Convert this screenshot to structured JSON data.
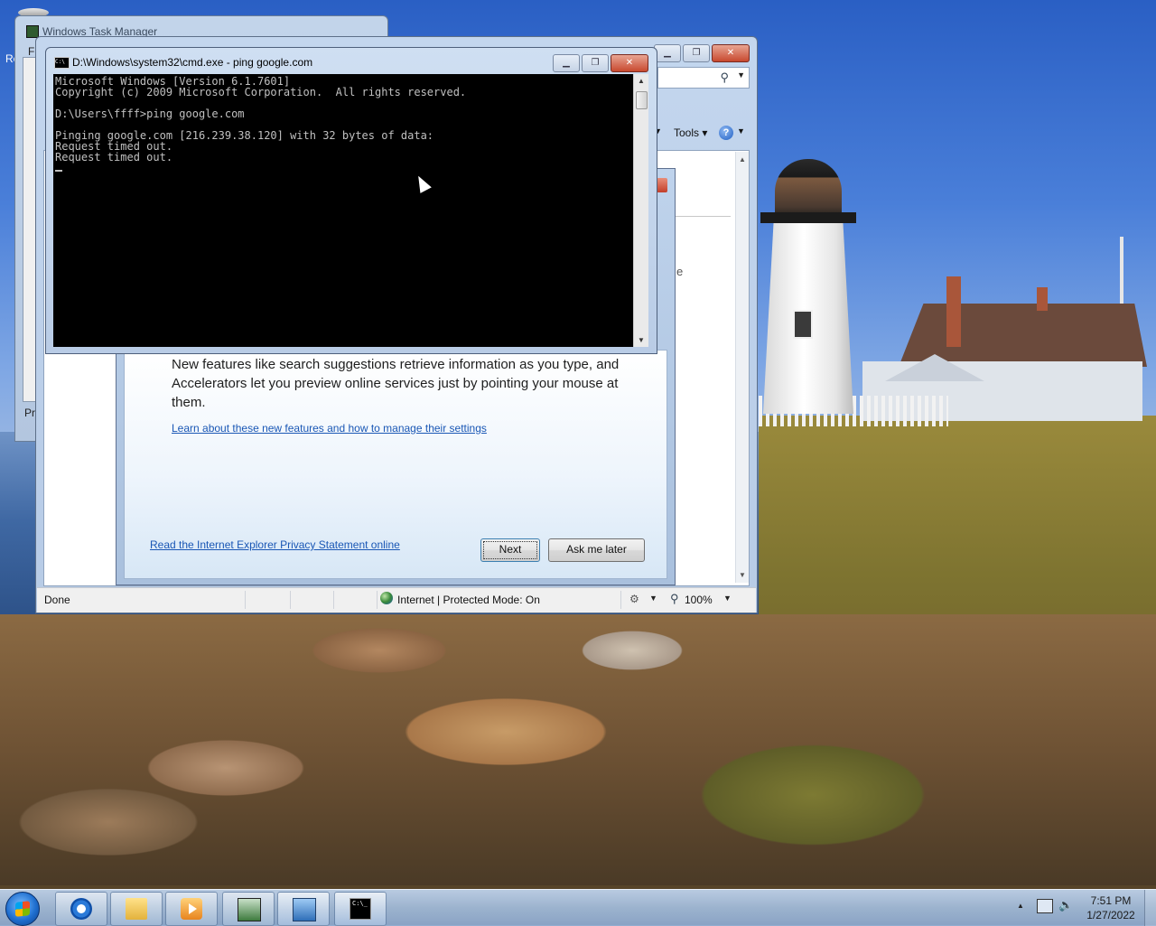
{
  "desktop": {
    "left_edge_label": "Re"
  },
  "task_manager": {
    "title": "Windows Task Manager",
    "menu_first": "Fi",
    "footer_partial": "Pr"
  },
  "ie_window": {
    "search_icon": "search-icon",
    "command_bar": {
      "tools_label": "Tools",
      "help_label": "?"
    },
    "content_partial_text": "e",
    "status_bar": {
      "status_text": "Done",
      "zone_text": "Internet | Protected Mode: On",
      "zoom_text": "100%"
    }
  },
  "welcome_dialog": {
    "description": "New features like search suggestions retrieve information as you type, and Accelerators let you preview online services just by pointing your mouse at them.",
    "features_link": "Learn about these new features and how to manage their settings",
    "privacy_link": "Read the Internet Explorer Privacy Statement online",
    "next_button": "Next",
    "ask_later_button": "Ask me later"
  },
  "cmd_window": {
    "title": "D:\\Windows\\system32\\cmd.exe - ping  google.com",
    "console_lines": [
      "Microsoft Windows [Version 6.1.7601]",
      "Copyright (c) 2009 Microsoft Corporation.  All rights reserved.",
      "",
      "D:\\Users\\ffff>ping google.com",
      "",
      "Pinging google.com [216.239.38.120] with 32 bytes of data:",
      "Request timed out.",
      "Request timed out."
    ]
  },
  "taskbar": {
    "buttons": [
      {
        "name": "internet-explorer",
        "icon": "ie-icon"
      },
      {
        "name": "windows-explorer",
        "icon": "folder-icon"
      },
      {
        "name": "media-player",
        "icon": "media-player-icon"
      },
      {
        "name": "task-manager",
        "icon": "task-manager-icon"
      },
      {
        "name": "remote-desktop",
        "icon": "remote-desktop-icon"
      },
      {
        "name": "command-prompt",
        "icon": "cmd-icon"
      }
    ],
    "clock_time": "7:51 PM",
    "clock_date": "1/27/2022"
  }
}
